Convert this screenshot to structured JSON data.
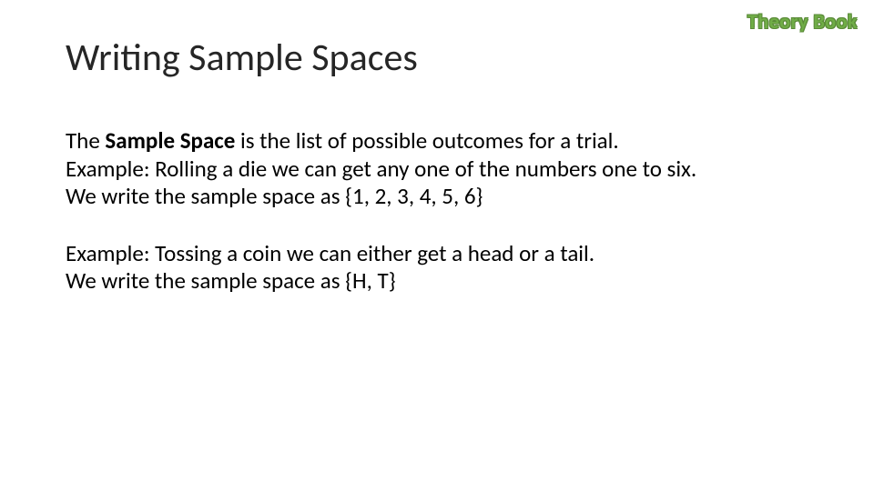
{
  "corner_label": "Theory Book",
  "title": "Writing Sample Spaces",
  "para1": {
    "lead": "The ",
    "bold": "Sample Space",
    "rest_line1": " is the list of possible outcomes for a trial.",
    "line2": "Example: Rolling a die we can get any one of the numbers one to six.",
    "line3": "We write the sample space as  {1, 2, 3, 4, 5, 6}"
  },
  "para2": {
    "line1": "Example: Tossing a coin we can either get a head or a tail.",
    "line2": "We write the sample space as {H, T}"
  }
}
